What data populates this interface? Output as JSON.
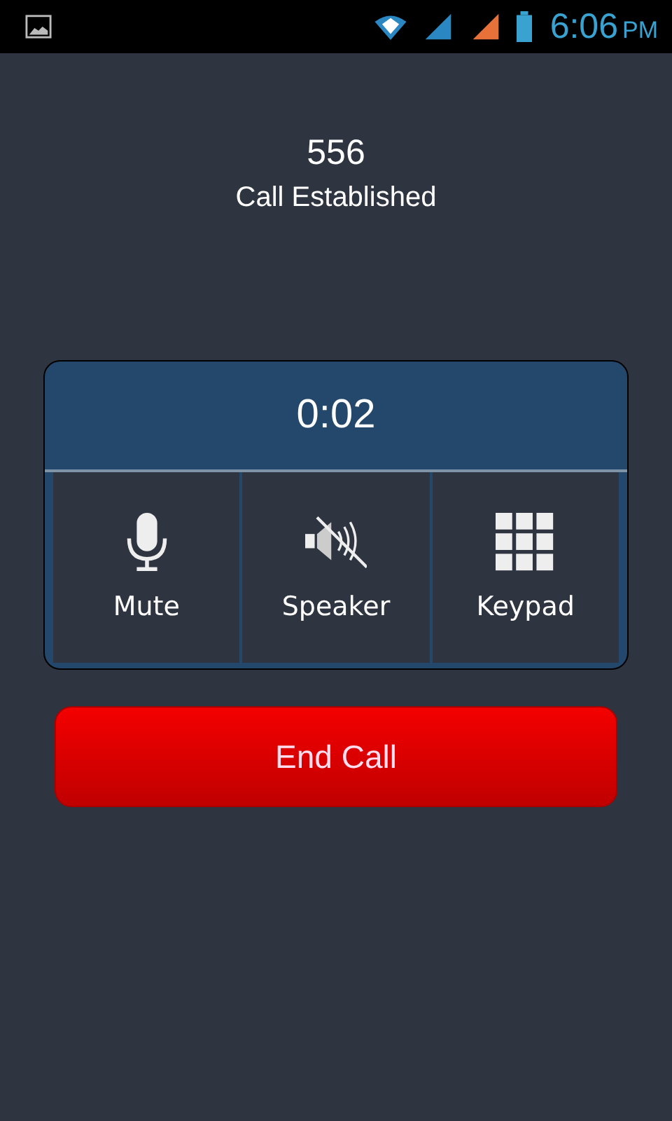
{
  "status_bar": {
    "time": "6:06",
    "meridiem": "PM"
  },
  "call": {
    "number": "556",
    "status": "Call Established",
    "duration": "0:02"
  },
  "controls": [
    {
      "kind": "mic",
      "label": "Mute"
    },
    {
      "kind": "speaker",
      "label": "Speaker"
    },
    {
      "kind": "keypad",
      "label": "Keypad"
    }
  ],
  "end_button": {
    "label": "End Call"
  }
}
